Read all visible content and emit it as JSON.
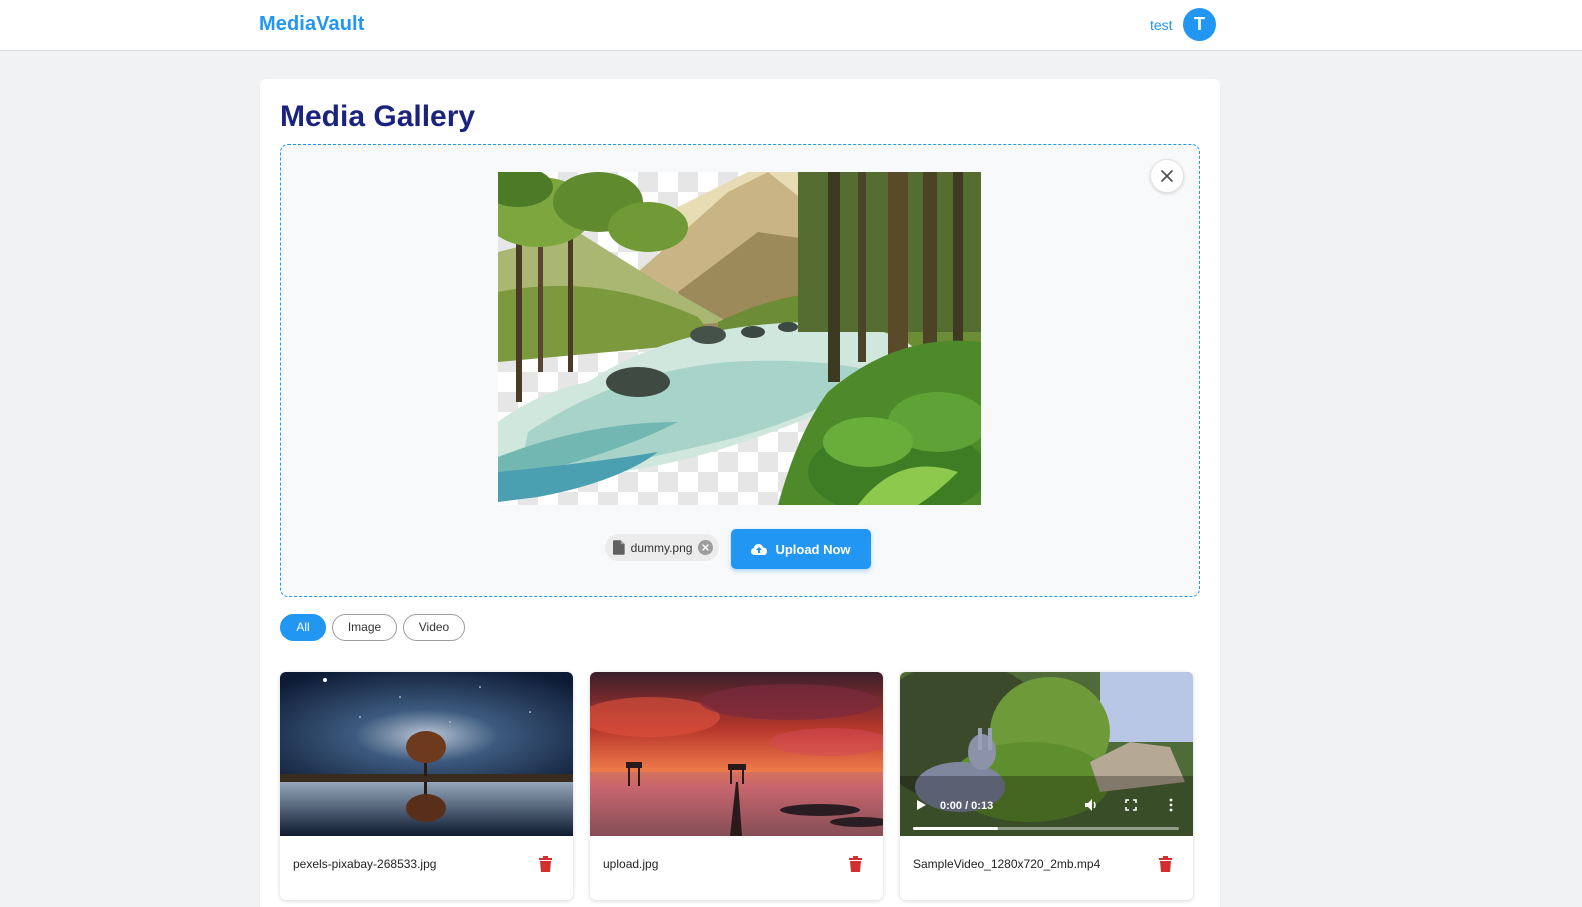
{
  "header": {
    "brand": "MediaVault",
    "username": "test",
    "avatar_initial": "T"
  },
  "page": {
    "title": "Media Gallery"
  },
  "upload": {
    "selected_file": "dummy.png",
    "upload_button_label": "Upload Now",
    "icons": {
      "close": "close-icon",
      "file": "file-icon",
      "remove": "remove-file-icon",
      "upload": "cloud-upload-icon"
    }
  },
  "filters": [
    {
      "label": "All",
      "active": true
    },
    {
      "label": "Image",
      "active": false
    },
    {
      "label": "Video",
      "active": false
    }
  ],
  "media": [
    {
      "name": "pexels-pixabay-268533.jpg",
      "type": "image"
    },
    {
      "name": "upload.jpg",
      "type": "image"
    },
    {
      "name": "SampleVideo_1280x720_2mb.mp4",
      "type": "video",
      "time": "0:00 / 0:13",
      "buffered": 0.32
    }
  ],
  "colors": {
    "accent": "#2196f3",
    "title": "#1a237e",
    "delete": "#d32f2f"
  }
}
